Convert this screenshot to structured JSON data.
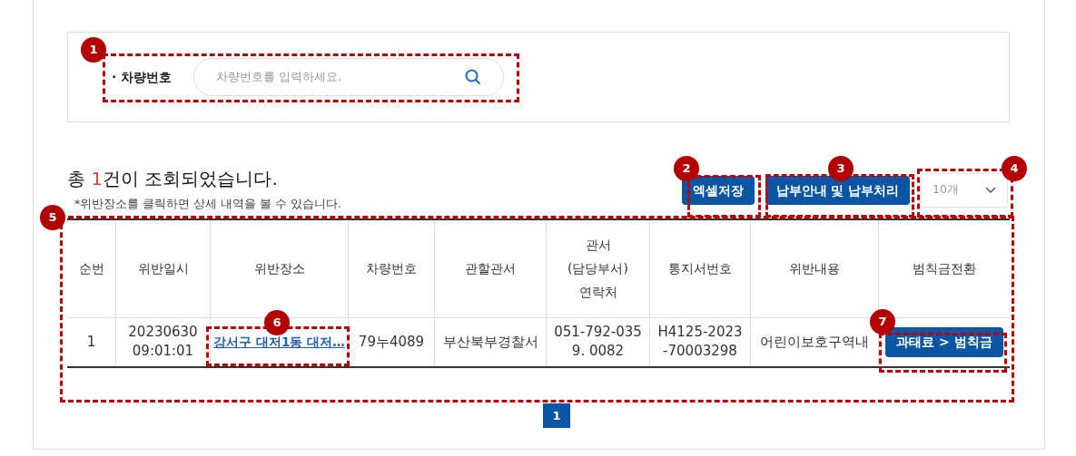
{
  "search": {
    "label": "· 차량번호",
    "placeholder": "차량번호를 입력하세요."
  },
  "result": {
    "prefix": "총 ",
    "count": "1",
    "suffix": "건이 조회되었습니다.",
    "note": "*위반장소를 클릭하면 상세 내역을 볼 수 있습니다."
  },
  "buttons": [
    {
      "label": "엑셀저장"
    },
    {
      "label": "납부안내 및 납부처리"
    }
  ],
  "page_size": {
    "value": "10개"
  },
  "table": {
    "columns": [
      "순번",
      "위반일시",
      "위반장소",
      "차량번호",
      "관할관서",
      "관서 (담당부서) 연락처",
      "통지서번호",
      "위반내용",
      "범칙금전환"
    ],
    "rows": [
      [
        {
          "kind": "text",
          "lines": [
            "1"
          ]
        },
        {
          "kind": "text",
          "lines": [
            "20230630",
            "09:01:01"
          ]
        },
        {
          "kind": "link",
          "lines": [
            "강서구 대저1동 대저…"
          ]
        },
        {
          "kind": "text",
          "lines": [
            "79누4089"
          ]
        },
        {
          "kind": "text",
          "lines": [
            "부산북부경찰서"
          ]
        },
        {
          "kind": "text",
          "lines": [
            "051-792-035",
            "9. 0082"
          ]
        },
        {
          "kind": "text",
          "lines": [
            "H4125-2023",
            "-70003298"
          ]
        },
        {
          "kind": "text",
          "lines": [
            "어린이보호구역내"
          ]
        },
        {
          "kind": "button",
          "lines": [
            "과태료 > 범칙금"
          ]
        }
      ]
    ]
  },
  "pagination": [
    {
      "label": "1",
      "selected": true
    }
  ],
  "annotations": [
    {
      "number": "1"
    },
    {
      "number": "2"
    },
    {
      "number": "3"
    },
    {
      "number": "4"
    },
    {
      "number": "5"
    },
    {
      "number": "6"
    },
    {
      "number": "7"
    }
  ]
}
